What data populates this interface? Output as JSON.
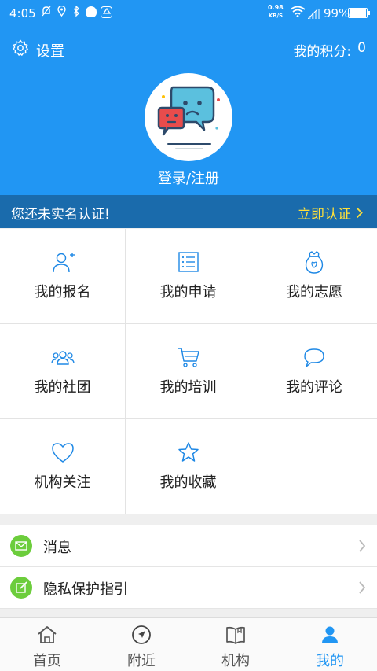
{
  "status_bar": {
    "time": "4:05",
    "net_speed_value": "0.98",
    "net_speed_unit": "KB/S",
    "battery": "99%"
  },
  "header": {
    "settings_label": "设置",
    "points_label": "我的积分:",
    "points_value": "0",
    "login_label": "登录/注册"
  },
  "verify_bar": {
    "message": "您还未实名认证!",
    "action_label": "立即认证"
  },
  "grid": [
    {
      "label": "我的报名",
      "icon": "person-add-icon"
    },
    {
      "label": "我的申请",
      "icon": "list-icon"
    },
    {
      "label": "我的志愿",
      "icon": "volunteer-bag-icon"
    },
    {
      "label": "我的社团",
      "icon": "group-icon"
    },
    {
      "label": "我的培训",
      "icon": "cart-icon"
    },
    {
      "label": "我的评论",
      "icon": "comment-icon"
    },
    {
      "label": "机构关注",
      "icon": "heart-icon"
    },
    {
      "label": "我的收藏",
      "icon": "star-icon"
    }
  ],
  "menu": [
    {
      "label": "消息",
      "icon": "mail-icon"
    },
    {
      "label": "隐私保护指引",
      "icon": "edit-icon"
    }
  ],
  "tabs": [
    {
      "label": "首页",
      "icon": "home-icon"
    },
    {
      "label": "附近",
      "icon": "compass-icon"
    },
    {
      "label": "机构",
      "icon": "book-icon"
    },
    {
      "label": "我的",
      "icon": "user-icon",
      "active": true
    }
  ],
  "colors": {
    "primary": "#2196f3",
    "verify_bar": "#1a6bac",
    "verify_action": "#ffe03a",
    "menu_icon": "#6ccd3c",
    "icon_line": "#1e88e5"
  }
}
